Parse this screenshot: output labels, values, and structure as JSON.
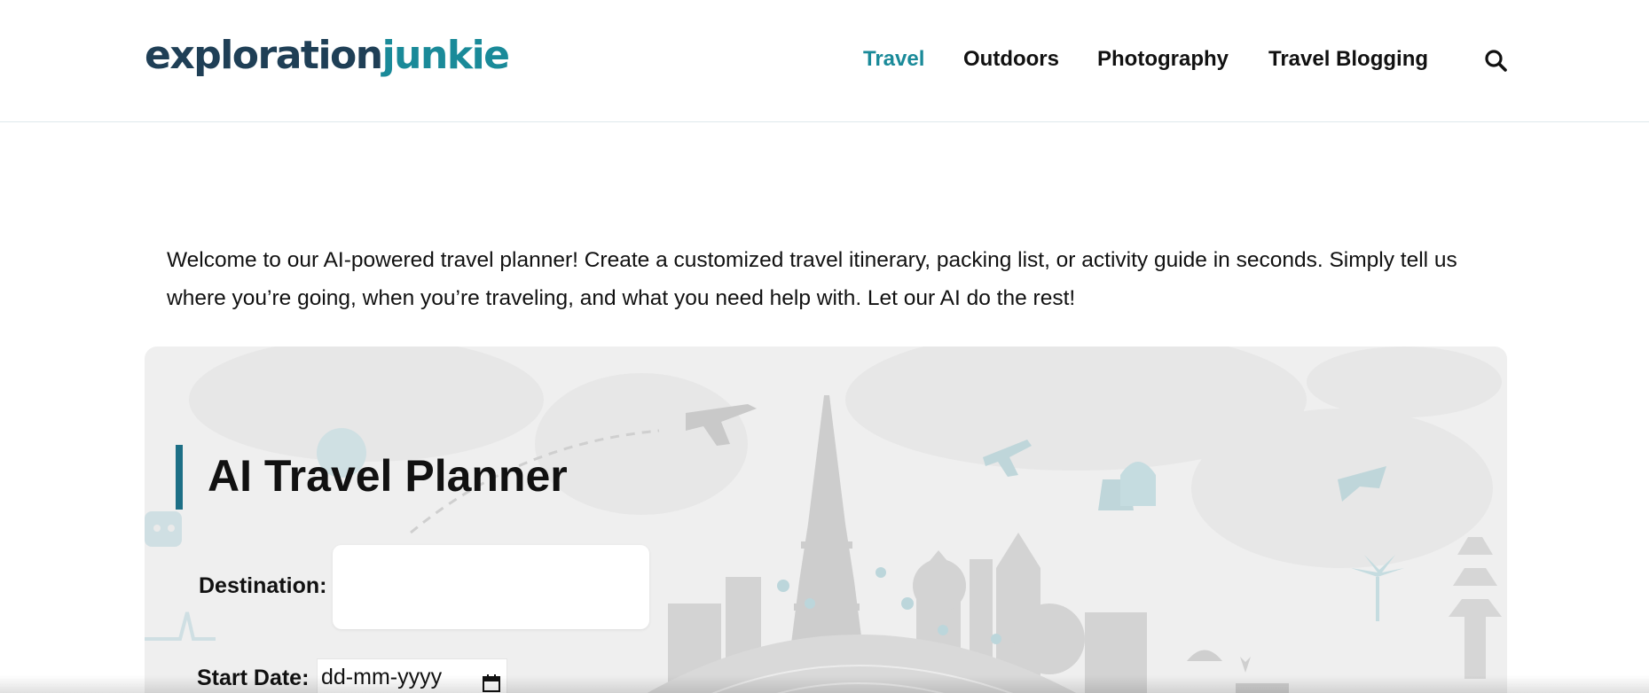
{
  "header": {
    "logo": {
      "part1": "exploration",
      "part2": "junkie"
    },
    "nav": [
      {
        "label": "Travel",
        "active": true
      },
      {
        "label": "Outdoors",
        "active": false
      },
      {
        "label": "Photography",
        "active": false
      },
      {
        "label": "Travel Blogging",
        "active": false
      }
    ],
    "search_icon": "search-icon"
  },
  "intro": {
    "text": "Welcome to our AI-powered travel planner! Create a customized travel itinerary, packing list, or activity guide in seconds. Simply tell us where you’re going, when you’re traveling, and what you need help with. Let our AI do the rest!"
  },
  "planner": {
    "title": "AI Travel Planner",
    "destination_label": "Destination:",
    "destination_value": "",
    "start_date_label": "Start Date:",
    "start_date_placeholder": "dd-mm-yyyy",
    "calendar_icon": "calendar-icon"
  },
  "colors": {
    "accent": "#1a8a99",
    "logo_dark": "#1f3f56",
    "title_bar": "#1d6f86",
    "panel_bg": "#efefef"
  }
}
